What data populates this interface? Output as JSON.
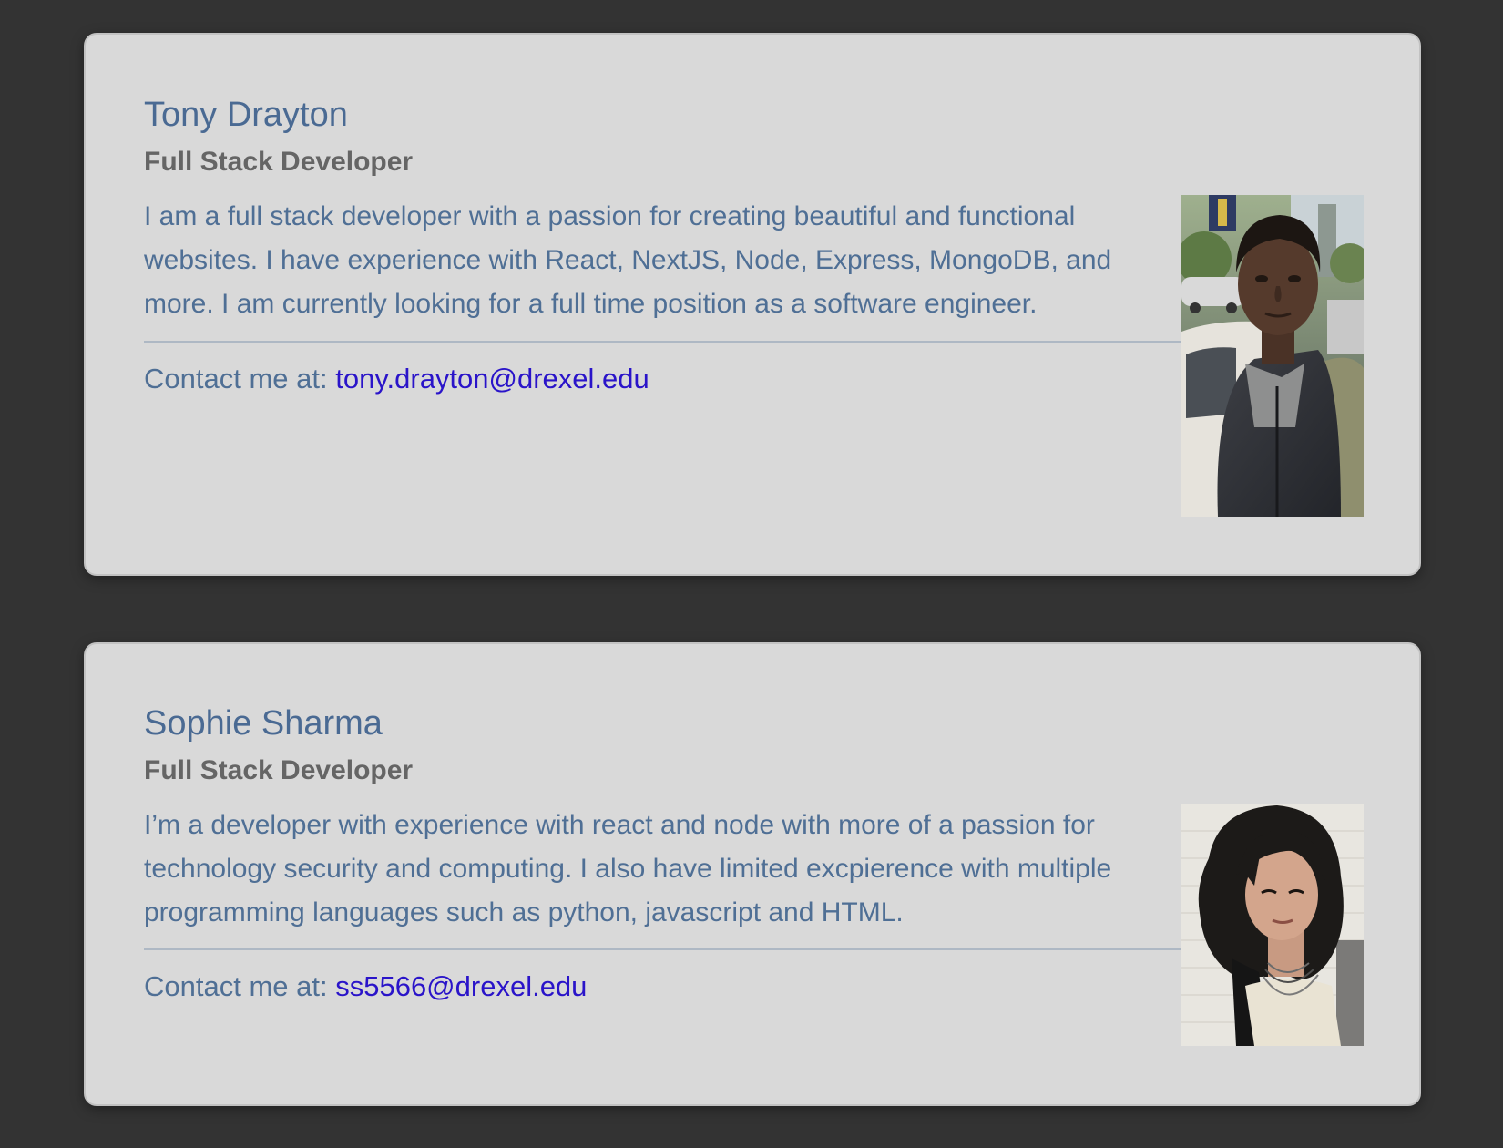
{
  "members": [
    {
      "name": "Tony Drayton",
      "role": "Full Stack Developer",
      "bio": "I am a full stack developer with a passion for creating beautiful and functional websites. I have experience with React, NextJS, Node, Express, MongoDB, and more. I am currently looking for a full time position as a software engineer.",
      "contact_prefix": "Contact me at: ",
      "email": "tony.drayton@drexel.edu"
    },
    {
      "name": "Sophie Sharma",
      "role": "Full Stack Developer",
      "bio": "I’m a developer with experience with react and node with more of a passion for technology security and computing. I also have limited excpierence with multiple programming languages such as python, javascript and HTML.",
      "contact_prefix": "Contact me at: ",
      "email": "ss5566@drexel.edu"
    }
  ],
  "colors": {
    "page_background": "#333333",
    "card_background": "#d9d9d9",
    "name": "#4a6a93",
    "role": "#656565",
    "body_text": "#4f6f95",
    "link": "#2a14c9"
  }
}
